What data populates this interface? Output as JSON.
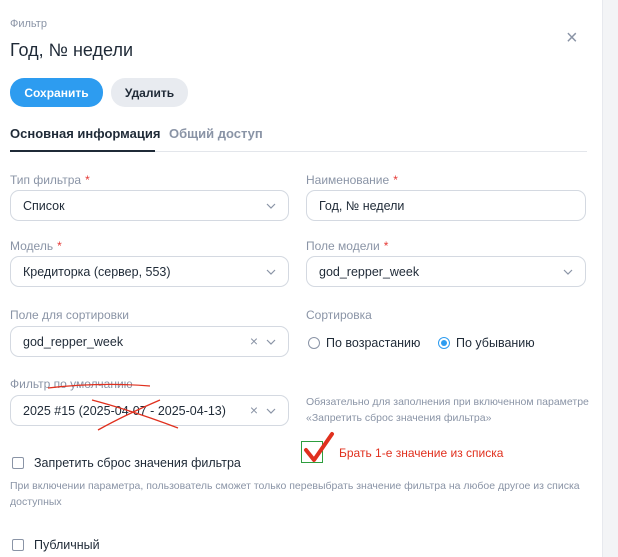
{
  "header": {
    "caption": "Фильтр",
    "title": "Год, № недели",
    "close_label": "×"
  },
  "toolbar": {
    "save_label": "Сохранить",
    "delete_label": "Удалить"
  },
  "tabs": [
    {
      "label": "Основная информация",
      "active": true
    },
    {
      "label": "Общий доступ",
      "active": false
    }
  ],
  "form": {
    "filter_type": {
      "label": "Тип фильтра",
      "required_mark": "*",
      "value": "Список"
    },
    "name": {
      "label": "Наименование",
      "required_mark": "*",
      "value": "Год, № недели"
    },
    "model": {
      "label": "Модель",
      "required_mark": "*",
      "value": "Кредиторка (сервер, 553)"
    },
    "model_field": {
      "label": "Поле модели",
      "required_mark": "*",
      "value": "god_repper_week"
    },
    "sort_field": {
      "label": "Поле для сортировки",
      "value": "god_repper_week"
    },
    "sort": {
      "label": "Сортировка",
      "options": [
        {
          "label": "По возрастанию",
          "selected": false
        },
        {
          "label": "По убыванию",
          "selected": true
        }
      ]
    },
    "default_filter": {
      "label": "Фильтр по умолчанию",
      "value": "2025 #15 (2025-04-07 - 2025-04-13)"
    },
    "default_hint": "Обязательно для заполнения при включенном параметре «Запретить сброс значения фильтра»",
    "forbid_reset": {
      "label": "Запретить сброс значения фильтра",
      "checked": false,
      "hint": "При включении параметра, пользователь сможет только перевыбрать значение фильтра на любое другое из списка доступных"
    },
    "public": {
      "label": "Публичный",
      "checked": false
    }
  },
  "annotations": {
    "note": "Брать 1-е значение из списка",
    "colors": {
      "mark": "#e0301e",
      "check_box": "#2e9e3e"
    }
  },
  "colors": {
    "accent": "#2d9cf0",
    "required": "#e53935",
    "muted": "#8a94a6",
    "border": "#d4d9e1"
  }
}
